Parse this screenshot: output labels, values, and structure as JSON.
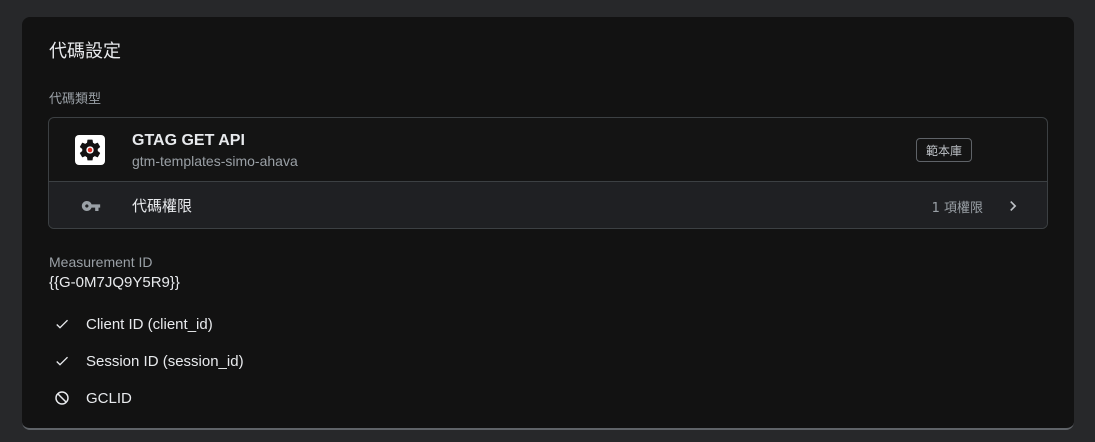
{
  "card": {
    "title": "代碼設定",
    "section_label": "代碼類型"
  },
  "tag": {
    "name": "GTAG GET API",
    "source": "gtm-templates-simo-ahava",
    "badge": "範本庫",
    "icon": "gear-icon"
  },
  "permissions": {
    "label": "代碼權限",
    "count": "1 項權限",
    "icon": "key-icon"
  },
  "measurement": {
    "label": "Measurement ID",
    "value": "{{G-0M7JQ9Y5R9}}"
  },
  "options": [
    {
      "label": "Client ID (client_id)",
      "state": "enabled",
      "icon": "check-icon"
    },
    {
      "label": "Session ID (session_id)",
      "state": "enabled",
      "icon": "check-icon"
    },
    {
      "label": "GCLID",
      "state": "disabled",
      "icon": "blocked-icon"
    }
  ],
  "colors": {
    "background": "#27282a",
    "card": "#121212",
    "text": "#e8eaed",
    "muted": "#9aa0a6"
  }
}
